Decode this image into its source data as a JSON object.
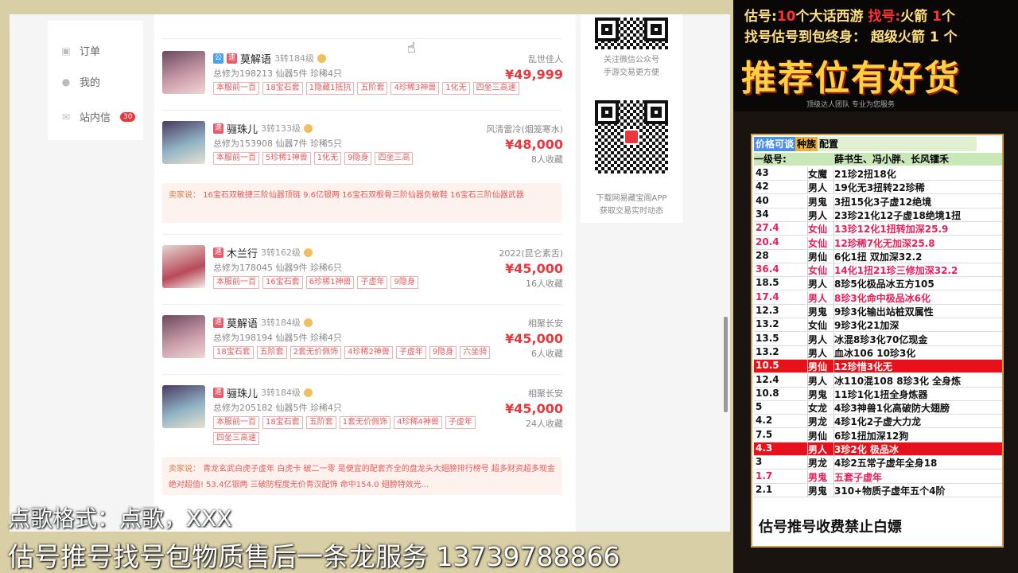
{
  "nav": {
    "orders": "订单",
    "mine": "我的",
    "inbox": "站内信",
    "inbox_count": "30"
  },
  "listings": [
    {
      "name": "莫解语",
      "level": "3转184级",
      "server": "乱世佳人",
      "stats": "总修为198213  仙器5件  珍稀4只",
      "price": "¥49,999",
      "favs": "",
      "chips": [
        "本服前一百",
        "18宝石套",
        "1隐藏1抵抗",
        "五阶套",
        "4珍稀3神兽",
        "1化无",
        "四坐三高速"
      ]
    },
    {
      "name": "骊珠儿",
      "level": "3转133级",
      "server": "风清雷冷(烟笼寒水)",
      "stats": "总修为153908  仙器7件  珍稀5只",
      "price": "¥48,000",
      "favs": "8人收藏",
      "chips": [
        "本服前一百",
        "5珍稀1神兽",
        "1化无",
        "9隐身",
        "四坐三高"
      ]
    },
    {
      "name": "木兰行",
      "level": "3转162级",
      "server": "2022(昆仑素舌)",
      "stats": "总修为178045  仙器9件  珍稀6只",
      "price": "¥45,000",
      "favs": "16人收藏",
      "chips": [
        "本服前一百",
        "16宝石套",
        "6珍稀1神兽",
        "子虚年",
        "9隐身"
      ]
    },
    {
      "name": "莫解语",
      "level": "3转184级",
      "server": "相聚长安",
      "stats": "总修为198194  仙器5件  珍稀4只",
      "price": "¥45,000",
      "favs": "6人收藏",
      "chips": [
        "18宝石套",
        "五阶套",
        "2套无价佩饰",
        "4珍稀2神兽",
        "子虚年",
        "9隐身",
        "六坐骑"
      ]
    },
    {
      "name": "骊珠儿",
      "level": "3转184级",
      "server": "相聚长安",
      "stats": "总修为205182  仙器5件  珍稀4只",
      "price": "¥45,000",
      "favs": "24人收藏",
      "chips": [
        "本服前一百",
        "18宝石套",
        "五阶套",
        "1套无价佩饰",
        "4珍稀4神兽",
        "子虚年",
        "四坐三高速"
      ]
    }
  ],
  "seller_notes": [
    {
      "label": "卖家说：",
      "text": "16宝石双敏捷三阶仙器顶链 9.6亿银两 16宝石双根骨三阶仙器负敏鞋 16宝石三阶仙器武器"
    },
    {
      "label": "卖家说：",
      "text": "青龙玄武白虎子虚年 白虎卡 破二一零 是便宜的配套齐全的盘龙头大翅膀排行榜号 超多财资超多现金 绝对超值! 53.4亿银两 三破防程度无价青汉配饰 命中154.0 翅膀特效光..."
    }
  ],
  "qr": {
    "wechat_line1": "关注微信公众号",
    "wechat_line2": "手游交易更方便",
    "app_line1": "下载网易藏宝阁APP",
    "app_line2": "获取交易实时动态"
  },
  "overlay": {
    "line1_a": "估号:",
    "line1_b": "10",
    "line1_c": "个大话西游",
    "line1_d": "找号:",
    "line1_e": "火箭",
    "line1_f": "1",
    "line1_g": "个",
    "line2": "找号估号到包终身： 超级火箭 1 个",
    "big": "推荐位有好货",
    "small": "顶级达人团队 专业为您服务"
  },
  "table": {
    "h1": "价格可谈",
    "h2": "种族",
    "h3": "配置",
    "sub_a": "一级号:",
    "sub_b": "薛书生、冯小胖、长风镭禾",
    "rows": [
      {
        "p": "43",
        "r": "女魔",
        "c": "21珍2扭18化",
        "s": ""
      },
      {
        "p": "42",
        "r": "男人",
        "c": "19化无3扭转22珍稀",
        "s": ""
      },
      {
        "p": "40",
        "r": "男鬼",
        "c": "3扭15化3子虚12绝境",
        "s": ""
      },
      {
        "p": "34",
        "r": "男人",
        "c": "23珍21化12子虚18绝境1扭",
        "s": ""
      },
      {
        "p": "27.4",
        "r": "女仙",
        "c": "13珍12化1扭转加深25.9",
        "s": "pink"
      },
      {
        "p": "20.4",
        "r": "女仙",
        "c": "12珍稀7化无加深25.8",
        "s": "pink"
      },
      {
        "p": "28",
        "r": "男仙",
        "c": "6化1扭  双加深32.2",
        "s": ""
      },
      {
        "p": "36.4",
        "r": "女仙",
        "c": "14化1扭21珍三修加深32.2",
        "s": "pink"
      },
      {
        "p": "18.5",
        "r": "男人",
        "c": "8珍5化极品冰五方105",
        "s": ""
      },
      {
        "p": "17.4",
        "r": "男人",
        "c": "8珍3化命中极品冰6化",
        "s": "pink"
      },
      {
        "p": "12.3",
        "r": "男鬼",
        "c": "9珍3化输出站桩双属性",
        "s": ""
      },
      {
        "p": "13.2",
        "r": "女仙",
        "c": "9珍3化21加深",
        "s": ""
      },
      {
        "p": "13.5",
        "r": "男人",
        "c": "冰混8珍3化70亿现金",
        "s": ""
      },
      {
        "p": "13.2",
        "r": "男人",
        "c": "血冰106  10珍3化",
        "s": ""
      },
      {
        "p": "10.5",
        "r": "男仙",
        "c": "12珍惜3化无",
        "s": "hl"
      },
      {
        "p": "12.4",
        "r": "男人",
        "c": "冰110混108  8珍3化  全身炼",
        "s": ""
      },
      {
        "p": "10.8",
        "r": "男鬼",
        "c": "11珍1化1扭全身炼器",
        "s": ""
      },
      {
        "p": "5",
        "r": "女龙",
        "c": "4珍3神兽1化高破防大翅膀",
        "s": ""
      },
      {
        "p": "4.2",
        "r": "男龙",
        "c": "4珍1化2子虚大力龙",
        "s": ""
      },
      {
        "p": "7.5",
        "r": "男仙",
        "c": "6珍1扭加深12狗",
        "s": ""
      },
      {
        "p": "4.3",
        "r": "男人",
        "c": "3珍2化  极品冰",
        "s": "hl"
      },
      {
        "p": "3",
        "r": "男龙",
        "c": "4珍2五常子虚年全身18",
        "s": ""
      },
      {
        "p": "1.7",
        "r": "男鬼",
        "c": "五套子虚年",
        "s": "pink"
      },
      {
        "p": "2.1",
        "r": "男鬼",
        "c": "310+物质子虚年五个4阶",
        "s": ""
      }
    ],
    "footer": "估号推号收费禁止白嫖"
  },
  "subtitle1": "点歌格式：点歌，XXX",
  "subtitle2": "估号推号找号包物质售后一条龙服务 13739788866",
  "tags": {
    "gong": "公",
    "su": "速"
  }
}
